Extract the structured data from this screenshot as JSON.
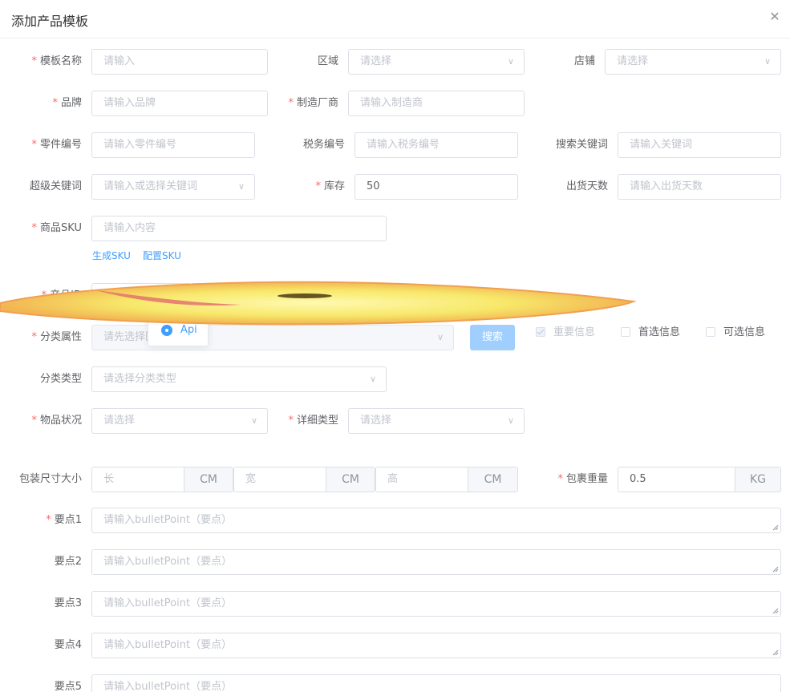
{
  "dialog": {
    "title": "添加产品模板",
    "close_icon": "close-icon"
  },
  "rows": {
    "r1": {
      "template_name": {
        "label": "模板名称",
        "placeholder": "请输入"
      },
      "region": {
        "label": "区域",
        "placeholder": "请选择"
      },
      "store": {
        "label": "店铺",
        "placeholder": "请选择"
      }
    },
    "r2": {
      "brand": {
        "label": "品牌",
        "placeholder": "请输入品牌"
      },
      "manufacturer": {
        "label": "制造厂商",
        "placeholder": "请输入制造商"
      }
    },
    "r3": {
      "part_no": {
        "label": "零件编号",
        "placeholder": "请输入零件编号"
      },
      "tax_no": {
        "label": "税务编号",
        "placeholder": "请输入税务编号"
      },
      "search_kw": {
        "label": "搜索关键词",
        "placeholder": "请输入关键词"
      }
    },
    "r4": {
      "super_kw": {
        "label": "超级关键词",
        "placeholder": "请输入或选择关键词"
      },
      "stock": {
        "label": "库存",
        "value": "50"
      },
      "ship_days": {
        "label": "出货天数",
        "placeholder": "请输入出货天数"
      }
    },
    "r5": {
      "sku": {
        "label": "商品SKU",
        "placeholder": "请输入内容"
      },
      "gen_sku": "生成SKU",
      "config_sku": "配置SKU"
    },
    "r6": {
      "product_id": {
        "label": "产品ID",
        "value": "ID"
      }
    },
    "r7": {
      "category_attr": {
        "label": "分类属性",
        "placeholder": "请先选择区"
      },
      "search_btn": "搜索",
      "important": "重要信息",
      "preferred": "首选信息",
      "optional": "可选信息",
      "popup_option": "Api"
    },
    "r8": {
      "category_type": {
        "label": "分类类型",
        "placeholder": "请选择分类类型"
      }
    },
    "r9": {
      "condition": {
        "label": "物品状况",
        "placeholder": "请选择"
      },
      "detail_type": {
        "label": "详细类型",
        "placeholder": "请选择"
      }
    },
    "r10": {
      "pkg_size": {
        "label": "包装尺寸大小",
        "length": "长",
        "width": "宽",
        "height": "高",
        "unit": "CM"
      },
      "pkg_weight": {
        "label": "包裹重量",
        "value": "0.5",
        "unit": "KG"
      }
    },
    "bullets": [
      {
        "label": "要点1",
        "placeholder": "请输入bulletPoint（要点）",
        "required": true
      },
      {
        "label": "要点2",
        "placeholder": "请输入bulletPoint（要点）",
        "required": false
      },
      {
        "label": "要点3",
        "placeholder": "请输入bulletPoint（要点）",
        "required": false
      },
      {
        "label": "要点4",
        "placeholder": "请输入bulletPoint（要点）",
        "required": false
      },
      {
        "label": "要点5",
        "placeholder": "请输入bulletPoint（要点）",
        "required": false
      }
    ]
  },
  "colors": {
    "primary": "#409eff",
    "required": "#f56c6c",
    "border": "#dcdfe6",
    "placeholder": "#c0c4cc"
  }
}
